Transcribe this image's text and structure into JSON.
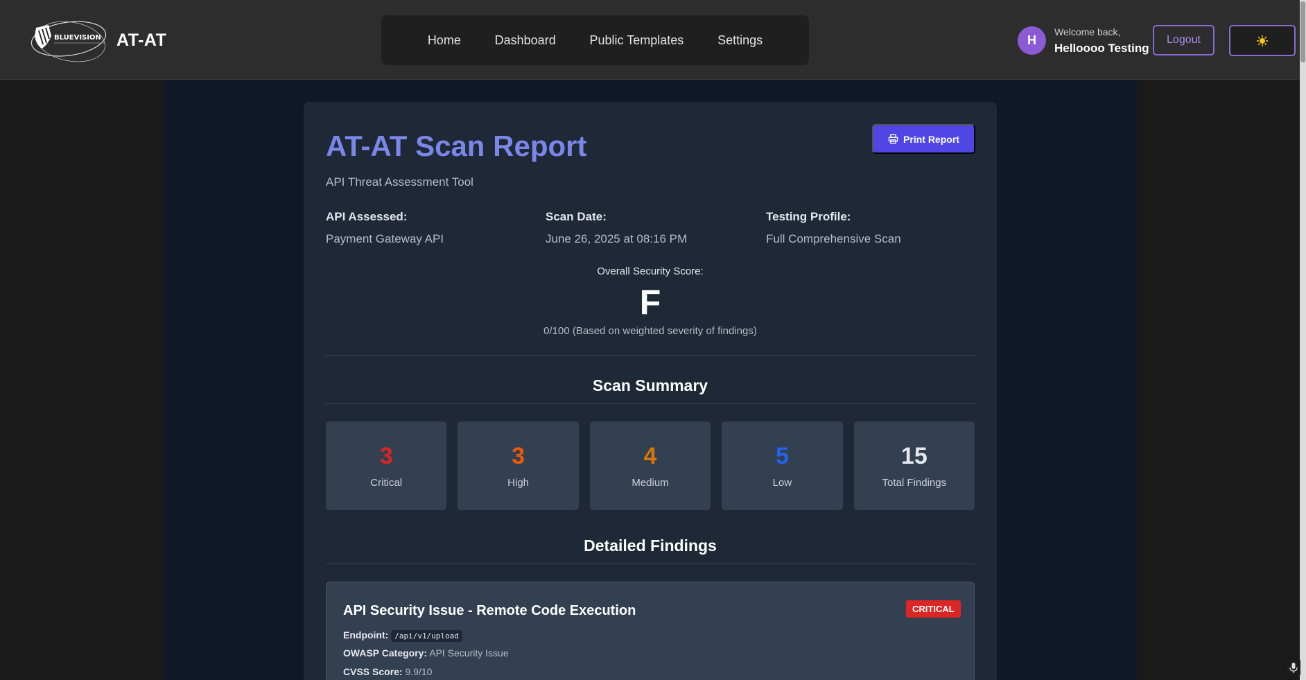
{
  "header": {
    "logo_text": "BLUEVISION",
    "brand": "AT-AT",
    "nav": [
      "Home",
      "Dashboard",
      "Public Templates",
      "Settings"
    ],
    "user": {
      "initial": "H",
      "welcome": "Welcome back,",
      "name": "Helloooo Testing"
    },
    "logout_label": "Logout",
    "theme_icon": "sun-icon"
  },
  "report": {
    "title": "AT-AT Scan Report",
    "subtitle": "API Threat Assessment Tool",
    "print_label": "Print Report",
    "meta": [
      {
        "label": "API Assessed:",
        "value": "Payment Gateway API"
      },
      {
        "label": "Scan Date:",
        "value": "June 26, 2025 at 08:16 PM"
      },
      {
        "label": "Testing Profile:",
        "value": "Full Comprehensive Scan"
      }
    ],
    "score": {
      "label": "Overall Security Score:",
      "grade": "F",
      "note": "0/100 (Based on weighted severity of findings)"
    }
  },
  "summary": {
    "title": "Scan Summary",
    "cards": [
      {
        "count": "3",
        "label": "Critical",
        "color": "#dc2626"
      },
      {
        "count": "3",
        "label": "High",
        "color": "#ea580c"
      },
      {
        "count": "4",
        "label": "Medium",
        "color": "#d97706"
      },
      {
        "count": "5",
        "label": "Low",
        "color": "#2563eb"
      },
      {
        "count": "15",
        "label": "Total Findings",
        "color": "#e6e7ee"
      }
    ]
  },
  "findings": {
    "title": "Detailed Findings",
    "items": [
      {
        "title": "API Security Issue - Remote Code Execution",
        "severity": "CRITICAL",
        "endpoint_label": "Endpoint:",
        "endpoint": "/api/v1/upload",
        "owasp_label": "OWASP Category:",
        "owasp": "API Security Issue",
        "cvss_label": "CVSS Score:",
        "cvss": "9.9/10"
      }
    ]
  }
}
